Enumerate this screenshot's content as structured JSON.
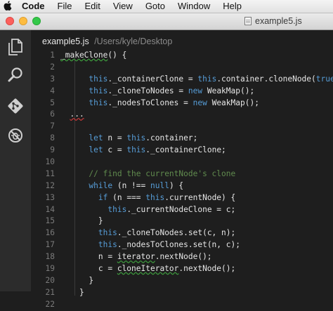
{
  "menubar": {
    "apple_icon": "apple-icon",
    "items": [
      "Code",
      "File",
      "Edit",
      "View",
      "Goto",
      "Window",
      "Help"
    ]
  },
  "window": {
    "title": "example5.js",
    "colors": {
      "close": "#fc605c",
      "minimize": "#fdbc40",
      "maximize": "#34c84a"
    }
  },
  "activity_bar": {
    "icons": [
      "files-icon",
      "search-icon",
      "git-icon",
      "debug-icon"
    ]
  },
  "editor": {
    "file_name": "example5.js",
    "file_path": "/Users/kyle/Desktop",
    "line_numbers": [
      "1",
      "2",
      "3",
      "4",
      "5",
      "6",
      "7",
      "8",
      "9",
      "10",
      "11",
      "12",
      "13",
      "14",
      "15",
      "16",
      "17",
      "18",
      "19",
      "20",
      "21",
      "22"
    ]
  }
}
